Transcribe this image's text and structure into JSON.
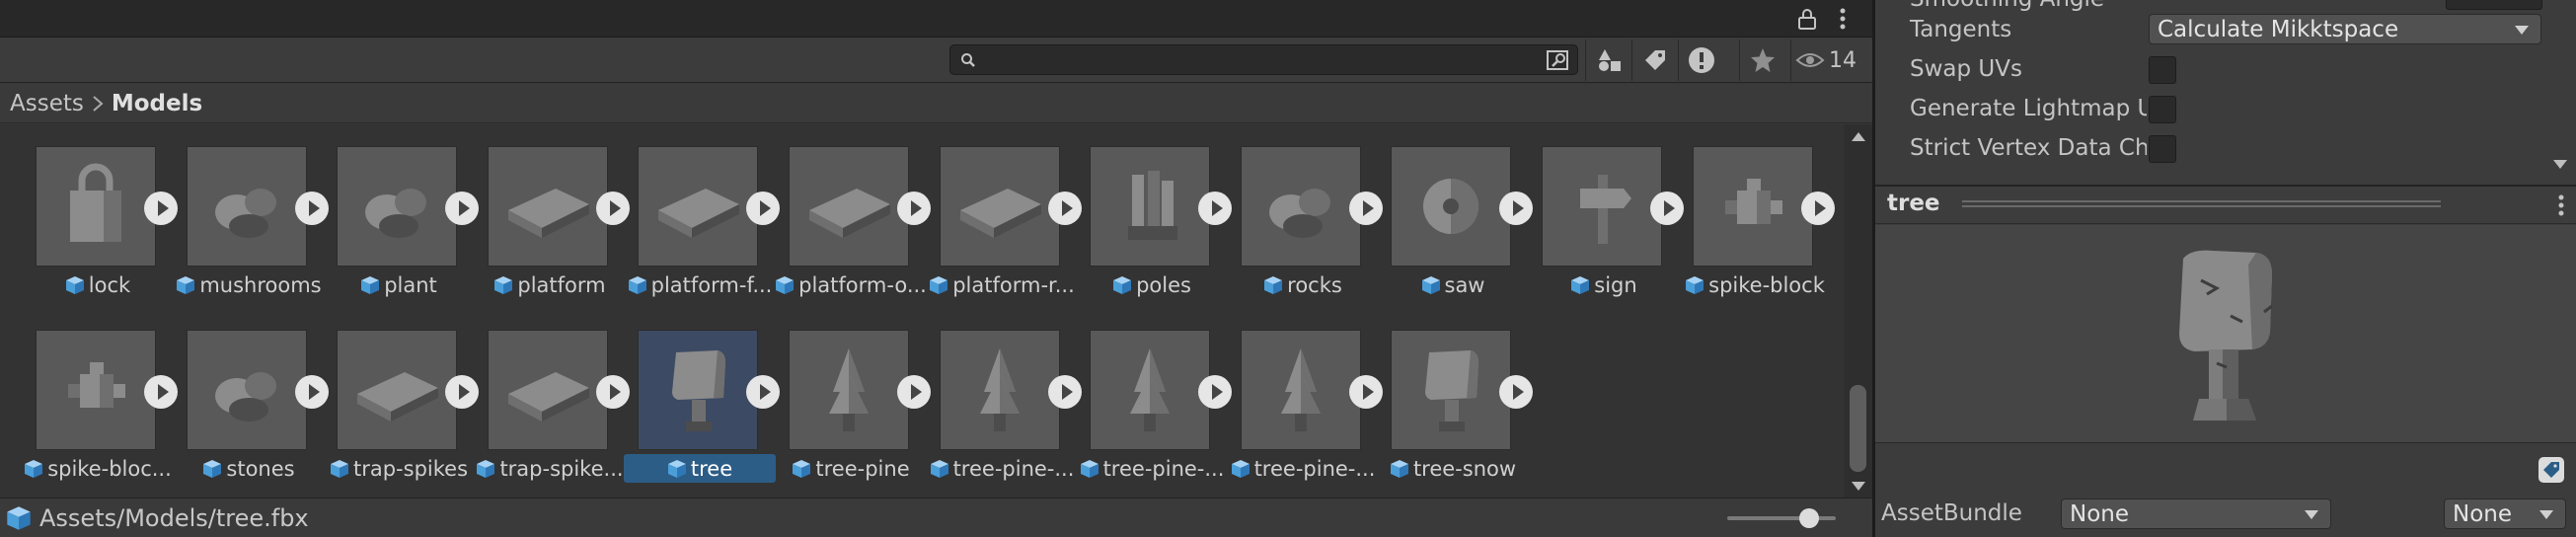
{
  "project_panel": {
    "search": {
      "placeholder": "",
      "value": ""
    },
    "hidden_count": "14",
    "breadcrumb": {
      "root": "Assets",
      "current": "Models"
    },
    "assets": [
      {
        "name": "lock"
      },
      {
        "name": "mushrooms"
      },
      {
        "name": "plant"
      },
      {
        "name": "platform"
      },
      {
        "name": "platform-f..."
      },
      {
        "name": "platform-o..."
      },
      {
        "name": "platform-r..."
      },
      {
        "name": "poles"
      },
      {
        "name": "rocks"
      },
      {
        "name": "saw"
      },
      {
        "name": "sign"
      },
      {
        "name": "spike-block"
      },
      {
        "name": "spike-bloc..."
      },
      {
        "name": "stones"
      },
      {
        "name": "trap-spikes"
      },
      {
        "name": "trap-spike..."
      },
      {
        "name": "tree",
        "selected": true
      },
      {
        "name": "tree-pine"
      },
      {
        "name": "tree-pine-..."
      },
      {
        "name": "tree-pine-..."
      },
      {
        "name": "tree-pine-..."
      },
      {
        "name": "tree-snow"
      }
    ],
    "status_path": "Assets/Models/tree.fbx",
    "icon_size_slider": 0.75
  },
  "inspector": {
    "smoothing_angle_label": "Smoothing Angle",
    "tangents_label": "Tangents",
    "tangents_value": "Calculate Mikktspace",
    "swap_uvs_label": "Swap UVs",
    "generate_lightmap_label": "Generate Lightmap U",
    "strict_vertex_label": "Strict Vertex Data Ch",
    "preview_title": "tree",
    "assetbundle_label": "AssetBundle",
    "assetbundle_value": "None",
    "assetbundle_variant": "None"
  },
  "colors": {
    "selection": "#2c5d87",
    "panel": "#383838",
    "inspector": "#3c3c3c",
    "thumbnail": "#595959"
  }
}
